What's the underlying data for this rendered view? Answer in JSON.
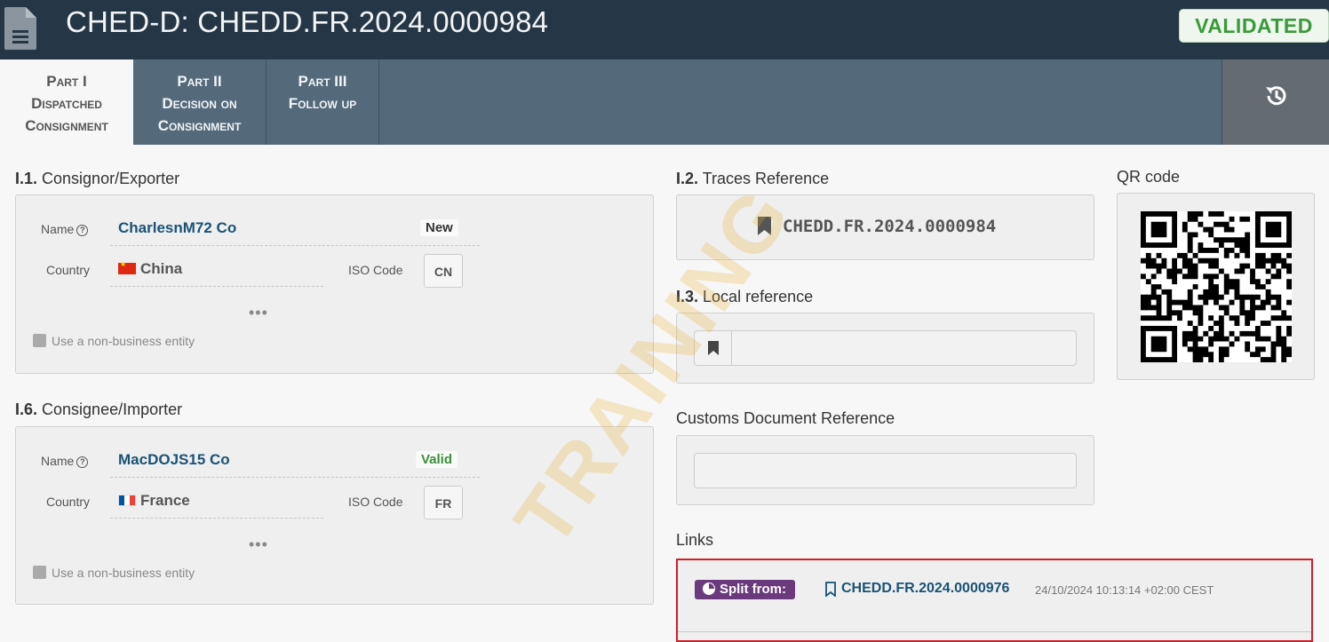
{
  "header": {
    "title": "CHED-D: CHEDD.FR.2024.0000984",
    "status": "VALIDATED",
    "icon": "document-icon"
  },
  "tabs": [
    {
      "line1": "Part I",
      "line2": "Dispatched",
      "line3": "Consignment",
      "active": true
    },
    {
      "line1": "Part II",
      "line2": "Decision on",
      "line3": "Consignment",
      "active": false
    },
    {
      "line1": "Part III",
      "line2": "Follow up",
      "active": false
    }
  ],
  "history_icon": "history-icon",
  "consignor": {
    "num": "I.1.",
    "title": "Consignor/Exporter",
    "name_label": "Name",
    "name": "CharlesnM72 Co",
    "status_tag": "New",
    "country_label": "Country",
    "country": "China",
    "iso_label": "ISO Code",
    "iso": "CN",
    "more": "•••",
    "non_business": "Use a non-business entity"
  },
  "consignee": {
    "num": "I.6.",
    "title": "Consignee/Importer",
    "name_label": "Name",
    "name": "MacDOJS15 Co",
    "status_tag": "Valid",
    "country_label": "Country",
    "country": "France",
    "iso_label": "ISO Code",
    "iso": "FR",
    "more": "•••",
    "non_business": "Use a non-business entity"
  },
  "traces": {
    "num": "I.2.",
    "title": "Traces Reference",
    "value": "CHEDD.FR.2024.0000984"
  },
  "local_ref": {
    "num": "I.3.",
    "title": "Local reference",
    "value": ""
  },
  "customs": {
    "title": "Customs Document Reference",
    "value": ""
  },
  "qr": {
    "title": "QR code"
  },
  "links": {
    "title": "Links",
    "badge": "Split from:",
    "ref": "CHEDD.FR.2024.0000976",
    "date": "24/10/2024 10:13:14 +02:00 CEST"
  },
  "colors": {
    "header_bg": "#253746",
    "tabs_bg": "#546a7b",
    "validated": "#3a9a3a",
    "link": "#1a5276",
    "split_badge": "#6b3a7d",
    "highlight_border": "#cc1f2a"
  }
}
